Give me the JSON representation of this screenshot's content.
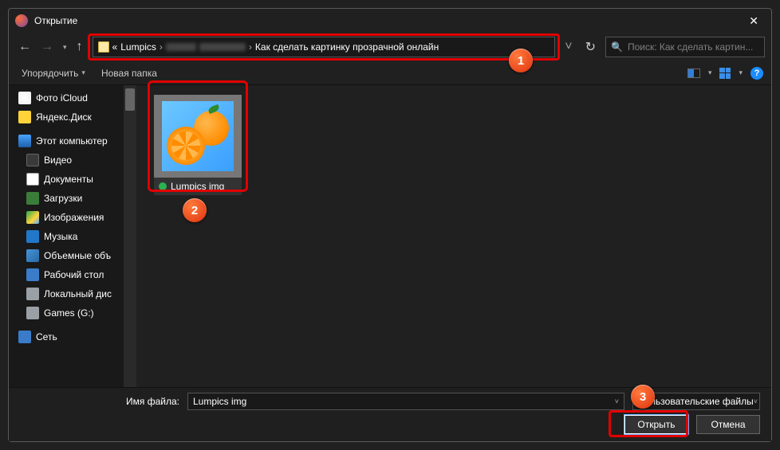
{
  "title": "Открытие",
  "nav": {
    "back": "←",
    "forward": "→",
    "up": "↑"
  },
  "breadcrumb": {
    "prefix": "«",
    "part1": "Lumpics",
    "part2": "Как сделать картинку прозрачной онлайн"
  },
  "search": {
    "placeholder": "Поиск: Как сделать картин..."
  },
  "toolbar": {
    "organize": "Упорядочить",
    "newfolder": "Новая папка"
  },
  "sidebar": {
    "items": [
      {
        "label": "Фото iCloud",
        "icon": "ico-icloud",
        "top": true
      },
      {
        "label": "Яндекс.Диск",
        "icon": "ico-yadisk",
        "top": true
      },
      {
        "label": "Этот компьютер",
        "icon": "ico-pc",
        "top": true
      },
      {
        "label": "Видео",
        "icon": "ico-video"
      },
      {
        "label": "Документы",
        "icon": "ico-docs"
      },
      {
        "label": "Загрузки",
        "icon": "ico-down"
      },
      {
        "label": "Изображения",
        "icon": "ico-img"
      },
      {
        "label": "Музыка",
        "icon": "ico-music"
      },
      {
        "label": "Объемные объ",
        "icon": "ico-3d"
      },
      {
        "label": "Рабочий стол",
        "icon": "ico-desk"
      },
      {
        "label": "Локальный дис",
        "icon": "ico-drive"
      },
      {
        "label": "Games (G:)",
        "icon": "ico-games"
      },
      {
        "label": "Сеть",
        "icon": "ico-net",
        "top": true
      }
    ]
  },
  "file": {
    "name": "Lumpics img"
  },
  "bottom": {
    "filename_label": "Имя файла:",
    "filename_value": "Lumpics img",
    "filetype_value": "Пользовательские файлы",
    "open": "Открыть",
    "cancel": "Отмена"
  },
  "markers": {
    "m1": "1",
    "m2": "2",
    "m3": "3"
  }
}
